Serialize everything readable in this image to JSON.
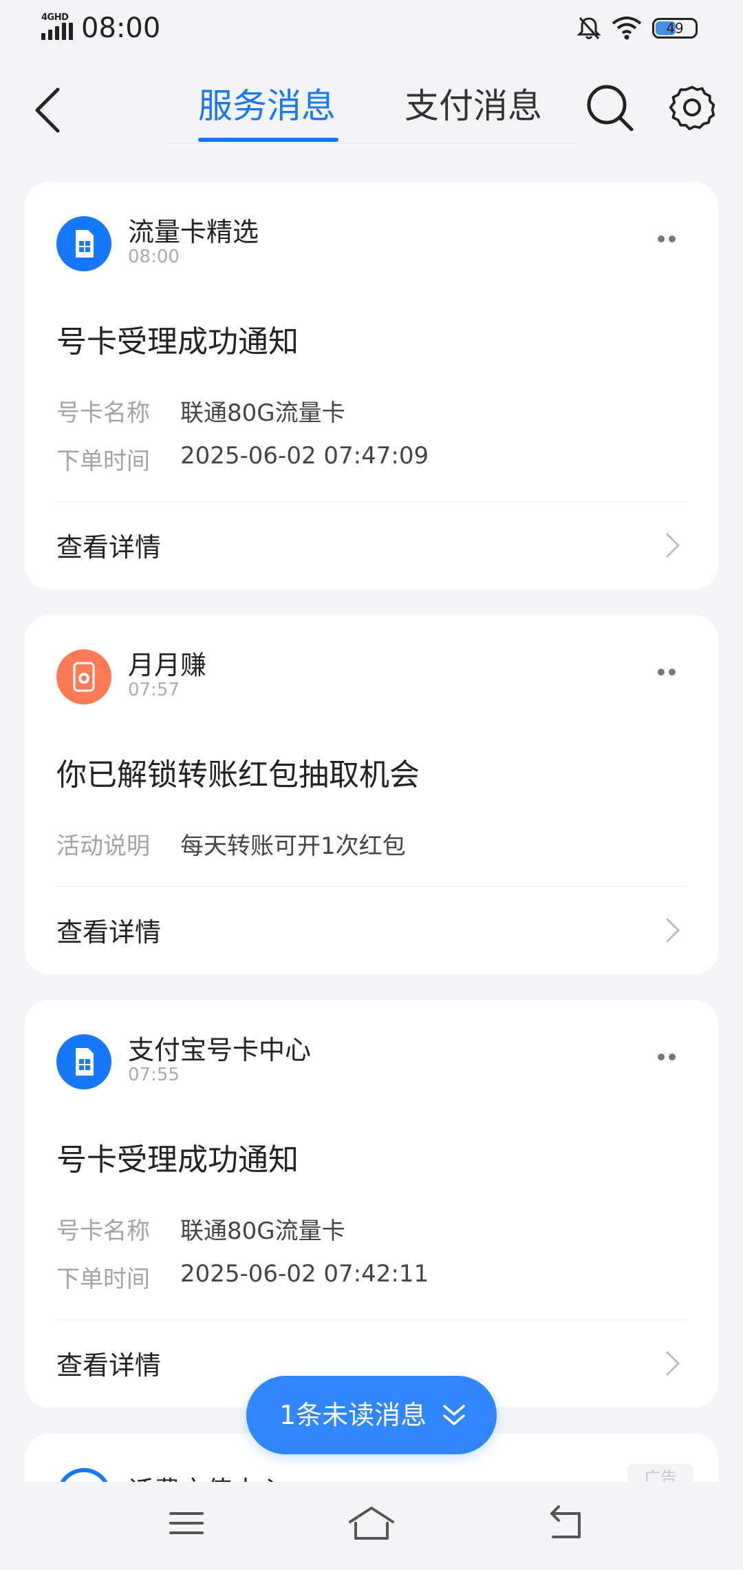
{
  "status_bar": {
    "network": "4GHD",
    "time": "08:00",
    "battery": "49"
  },
  "header": {
    "tabs": [
      {
        "label": "服务消息"
      },
      {
        "label": "支付消息"
      }
    ]
  },
  "cards": [
    {
      "sender": "流量卡精选",
      "time": "08:00",
      "title": "号卡受理成功通知",
      "fields": [
        {
          "label": "号卡名称",
          "value": "联通80G流量卡"
        },
        {
          "label": "下单时间",
          "value": "2025-06-02 07:47:09"
        }
      ],
      "link": "查看详情"
    },
    {
      "sender": "月月赚",
      "time": "07:57",
      "title": "你已解锁转账红包抽取机会",
      "fields": [
        {
          "label": "活动说明",
          "value": "每天转账可开1次红包"
        }
      ],
      "link": "查看详情"
    },
    {
      "sender": "支付宝号卡中心",
      "time": "07:55",
      "title": "号卡受理成功通知",
      "fields": [
        {
          "label": "号卡名称",
          "value": "联通80G流量卡"
        },
        {
          "label": "下单时间",
          "value": "2025-06-02 07:42:11"
        }
      ],
      "link": "查看详情"
    },
    {
      "sender": "话费充值中心",
      "badge": "广告"
    }
  ],
  "unread": {
    "label": "1条未读消息"
  },
  "icons": {
    "back": "chevron-left-icon",
    "search": "search-icon",
    "settings": "gear-icon",
    "more": "more-dots-icon",
    "unread": "double-chevron-down-icon",
    "nav_menu": "menu-icon",
    "nav_home": "home-icon",
    "nav_back": "back-return-icon"
  },
  "colors": {
    "accent": "#1677ff",
    "pill": "#2f86ff",
    "orange": "#ff7a55"
  }
}
